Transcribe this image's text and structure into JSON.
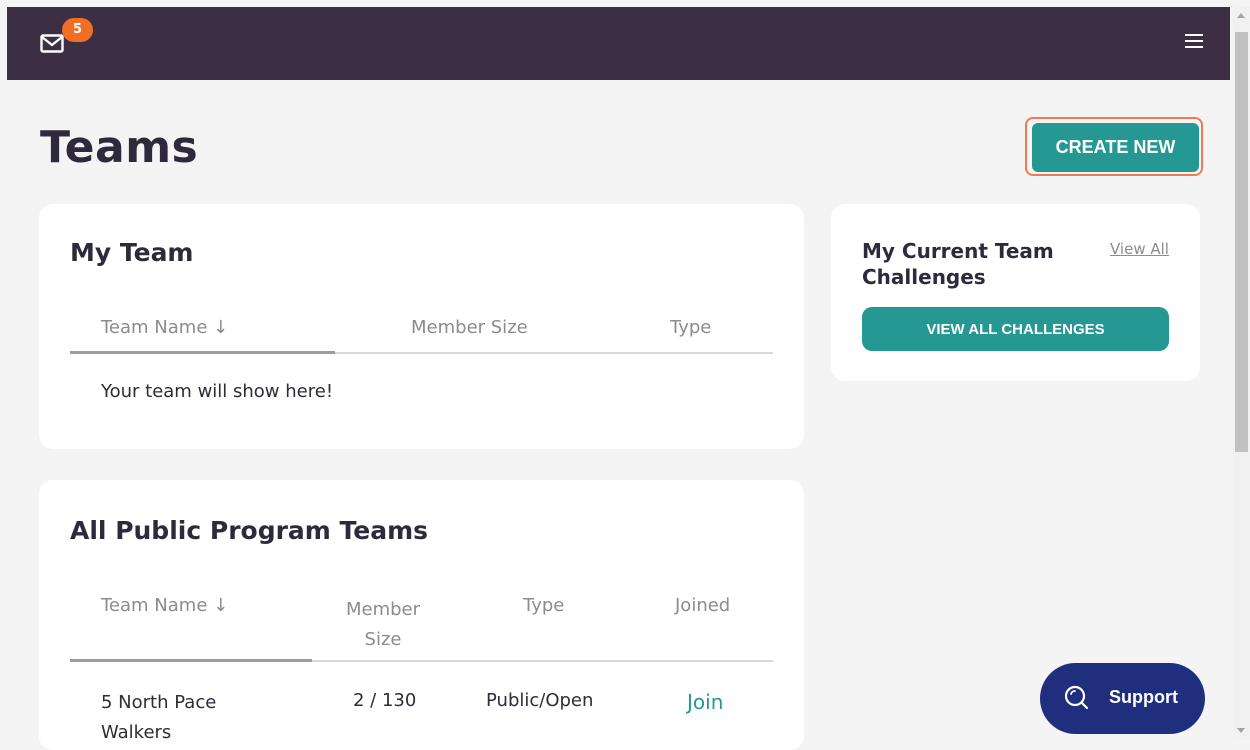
{
  "header": {
    "mail_badge": "5",
    "mail_icon": "envelope",
    "menu_icon": "hamburger"
  },
  "page": {
    "title": "Teams",
    "create_button": "CREATE NEW"
  },
  "my_team": {
    "title": "My Team",
    "columns": [
      "Team Name ↓",
      "Member Size",
      "Type"
    ],
    "empty_message": "Your team will show here!"
  },
  "challenges": {
    "title_line1": "My Current Team",
    "title_line2": "Challenges",
    "view_all": "View All",
    "button": "VIEW ALL CHALLENGES"
  },
  "public_teams": {
    "title": "All Public Program Teams",
    "columns": {
      "name": "Team Name ↓",
      "size_line1": "Member",
      "size_line2": "Size",
      "type": "Type",
      "joined": "Joined"
    },
    "rows": [
      {
        "name_line1": "5 North Pace",
        "name_line2": "Walkers",
        "size": "2 / 130",
        "type": "Public/Open",
        "action": "Join"
      }
    ]
  },
  "support": {
    "label": "Support",
    "icon": "search"
  },
  "colors": {
    "topbar": "#3d2f43",
    "accent_teal": "#259894",
    "badge_orange": "#f26e24",
    "support_navy": "#1f2f7e",
    "focus_outline": "#f07a4f"
  }
}
